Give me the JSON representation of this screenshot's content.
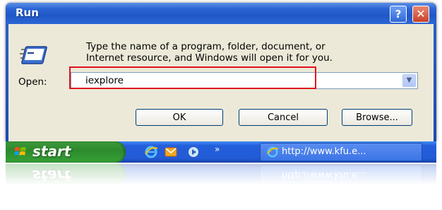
{
  "dialog": {
    "title": "Run",
    "help_icon": "question-mark-icon",
    "close_icon": "close-x-icon",
    "run_icon": "run-dialog-icon",
    "description_line1": "Type the name of a program, folder, document, or",
    "description_line2": "Internet resource, and Windows will open it for you.",
    "open_label": "Open:",
    "open_value": "iexplore",
    "dropdown_icon": "chevron-down-icon",
    "buttons": {
      "ok": "OK",
      "cancel": "Cancel",
      "browse": "Browse..."
    },
    "highlight_color": "#e0141e"
  },
  "taskbar": {
    "start_label": "start",
    "start_icon": "windows-flag-icon",
    "quick_launch": [
      "internet-explorer-icon",
      "outlook-express-icon",
      "media-player-icon"
    ],
    "overflow_label": "»",
    "task_button": {
      "icon": "internet-explorer-icon",
      "label": "http://www.kfu.e..."
    }
  },
  "colors": {
    "title_bar": "#2a63d4",
    "dialog_body": "#ece9d8",
    "taskbar": "#245edb",
    "start_button": "#36a136"
  }
}
